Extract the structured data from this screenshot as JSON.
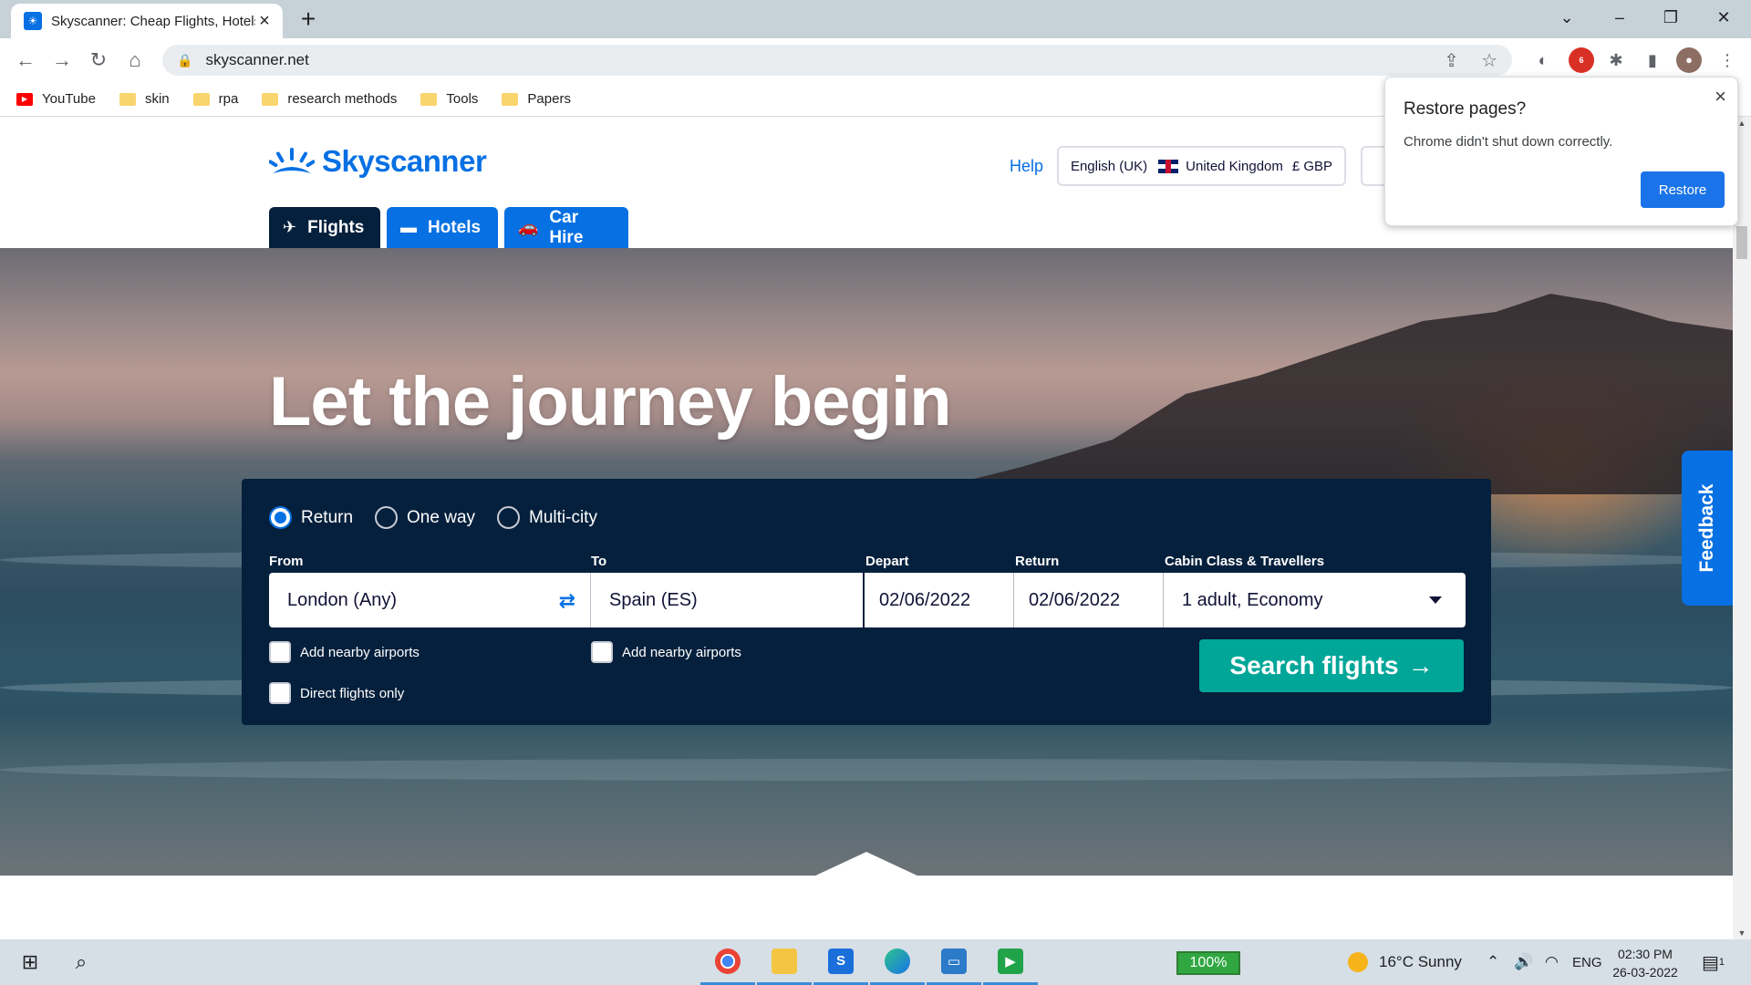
{
  "browser": {
    "tab_title": "Skyscanner: Cheap Flights, Hotels",
    "url": "skyscanner.net",
    "bookmarks": [
      "YouTube",
      "skin",
      "rpa",
      "research methods",
      "Tools",
      "Papers"
    ],
    "abp_badge": "6"
  },
  "header": {
    "brand": "Skyscanner",
    "help": "Help",
    "language": "English (UK)",
    "country": "United Kingdom",
    "currency": "£ GBP"
  },
  "product_tabs": [
    "Flights",
    "Hotels",
    "Car Hire"
  ],
  "hero": {
    "headline": "Let the journey begin"
  },
  "search": {
    "trip_types": [
      "Return",
      "One way",
      "Multi-city"
    ],
    "selected_trip": "Return",
    "labels": {
      "from": "From",
      "to": "To",
      "depart": "Depart",
      "return": "Return",
      "cabin": "Cabin Class & Travellers"
    },
    "from_value": "London (Any)",
    "to_value": "Spain (ES)",
    "depart_value": "02/06/2022",
    "return_value": "02/06/2022",
    "cabin_value": "1 adult, Economy",
    "nearby_from": "Add nearby airports",
    "nearby_to": "Add nearby airports",
    "direct_only": "Direct flights only",
    "button": "Search flights"
  },
  "feedback": "Feedback",
  "restore_popup": {
    "title": "Restore pages?",
    "message": "Chrome didn't shut down correctly.",
    "button": "Restore"
  },
  "taskbar": {
    "battery": "100%",
    "weather": "16°C  Sunny",
    "lang": "ENG",
    "time": "02:30 PM",
    "date": "26-03-2022",
    "notifications": "1"
  },
  "colors": {
    "brand": "#0770e3",
    "navy": "#05203c",
    "search_btn": "#00a698"
  }
}
